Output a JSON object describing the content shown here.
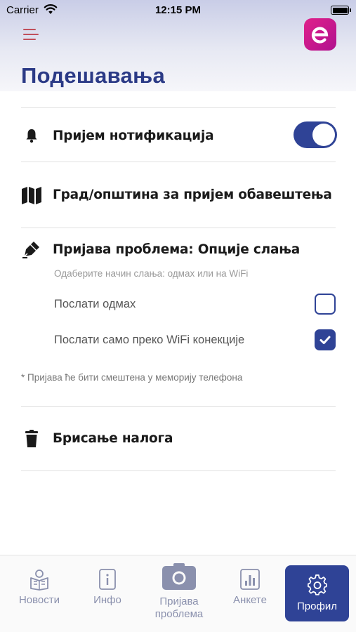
{
  "status_bar": {
    "carrier": "Carrier",
    "time": "12:15 PM"
  },
  "header": {
    "title": "Подешавања",
    "menu_icon": "hamburger-menu-icon",
    "logo_icon": "e-logo-icon"
  },
  "settings": {
    "notifications": {
      "label": "Пријем нотификација",
      "icon": "bell-icon",
      "enabled": true
    },
    "city": {
      "label": "Град/општина за пријем обавештења",
      "icon": "map-icon"
    },
    "report": {
      "label": "Пријава проблема: Опције слања",
      "icon": "pen-icon",
      "subtitle": "Одаберите начин слања: одмах или на WiFi",
      "options": [
        {
          "label": "Послати одмах",
          "checked": false
        },
        {
          "label": "Послати само преко WiFi конекције",
          "checked": true
        }
      ],
      "note": "* Пријава ће бити смештена у меморију телефона"
    },
    "delete_account": {
      "label": "Брисање налога",
      "icon": "trash-icon"
    }
  },
  "tabs": [
    {
      "label": "Новости",
      "icon": "news-reader-icon"
    },
    {
      "label": "Инфо",
      "icon": "info-book-icon"
    },
    {
      "label": "Пријава проблема",
      "line1": "Пријава",
      "line2": "проблема",
      "icon": "camera-icon"
    },
    {
      "label": "Анкете",
      "icon": "poll-chart-icon"
    },
    {
      "label": "Профил",
      "icon": "gear-icon",
      "active": true
    }
  ],
  "colors": {
    "accent": "#2f4396",
    "title": "#2b3a86",
    "logo": "#e0218a",
    "menu": "#c0505c"
  }
}
